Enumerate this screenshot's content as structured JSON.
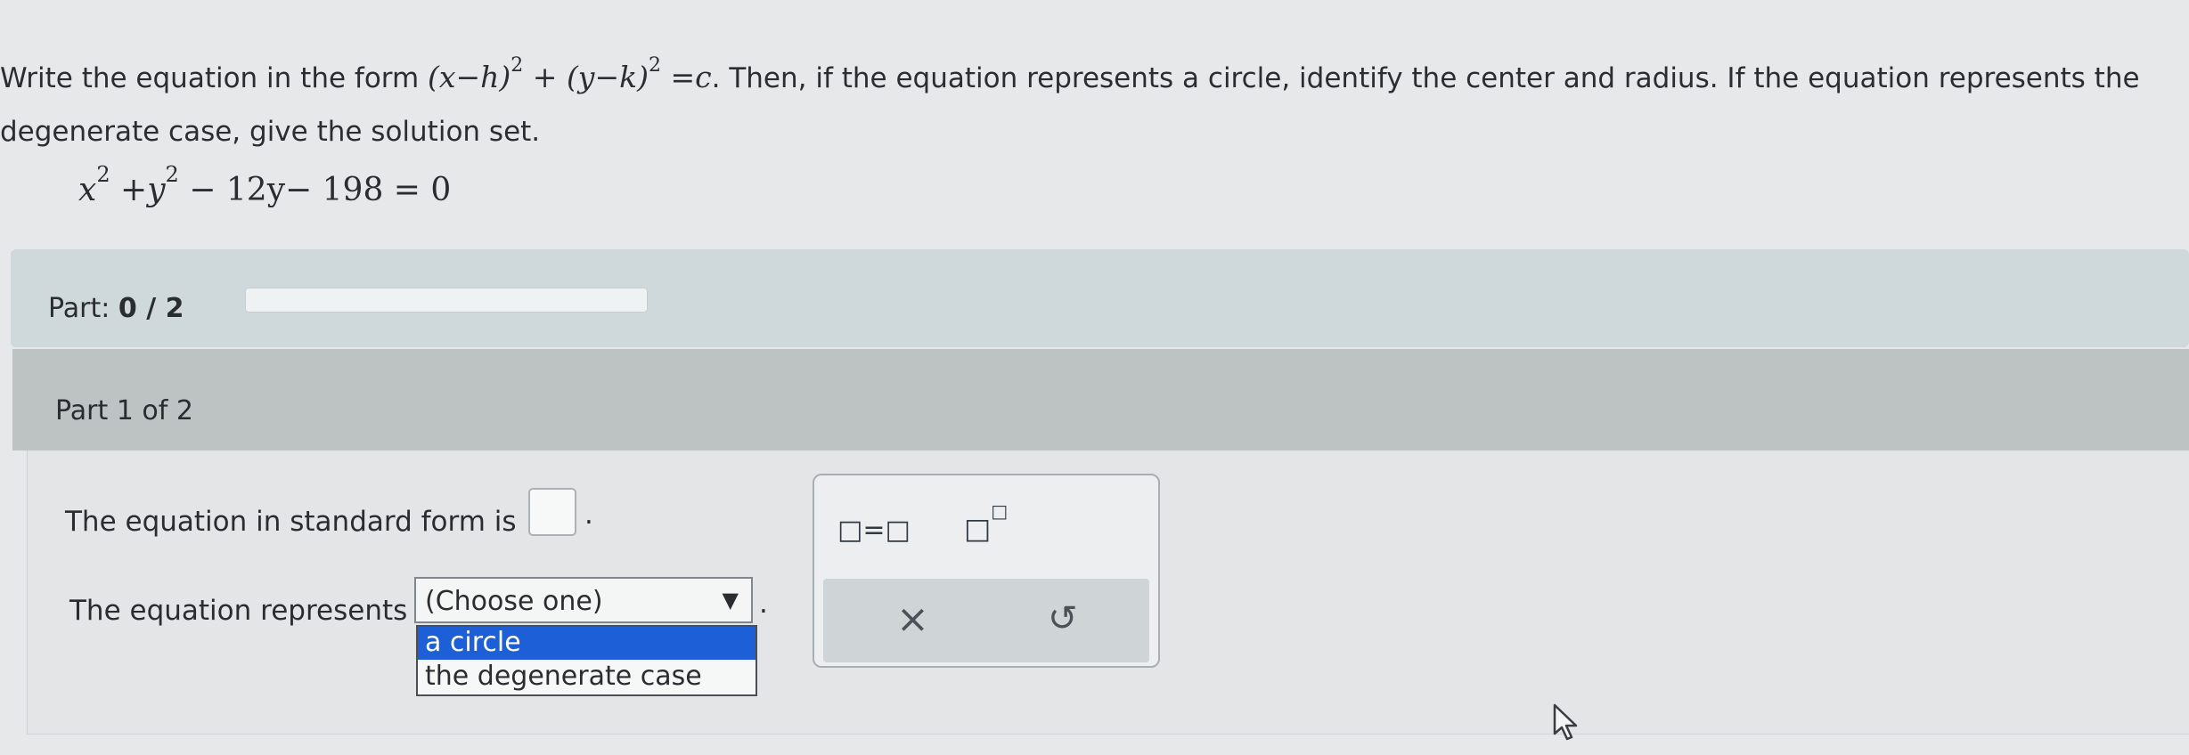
{
  "prompt": {
    "before": "Write the equation in the form ",
    "form_base": "(x−h)",
    "form_exp": "2",
    "form_plus": " + ",
    "form_base2": "(y−k)",
    "form_exp2": "2",
    "form_eq": " =c",
    "after": ". Then, if the equation represents a circle, identify the center and radius. If the equation represents the degenerate case, give the solution set."
  },
  "given_equation": {
    "x": "x",
    "x_exp": "2",
    "plus": " +",
    "y": "y",
    "y_exp": "2",
    "rest": " − 12y− 198 = 0"
  },
  "part_progress": {
    "label": "Part: ",
    "value": "0 / 2",
    "fraction": 0
  },
  "part_title": "Part 1 of 2",
  "question": {
    "standard_form_label": "The equation in standard form is",
    "standard_form_value": "",
    "represents_label": "The equation represents",
    "select_value": "(Choose one)",
    "options": [
      "a circle",
      "the degenerate case"
    ],
    "highlighted_option": 0
  },
  "toolbox": {
    "equals_tool": "□=□",
    "sup_base": "□",
    "sup_exp": "□",
    "clear_symbol": "×",
    "undo_symbol": "↺"
  },
  "icons": {
    "dropdown": "triangle-down-icon",
    "clear": "close-icon",
    "undo": "undo-icon",
    "cursor": "mouse-pointer-icon"
  }
}
